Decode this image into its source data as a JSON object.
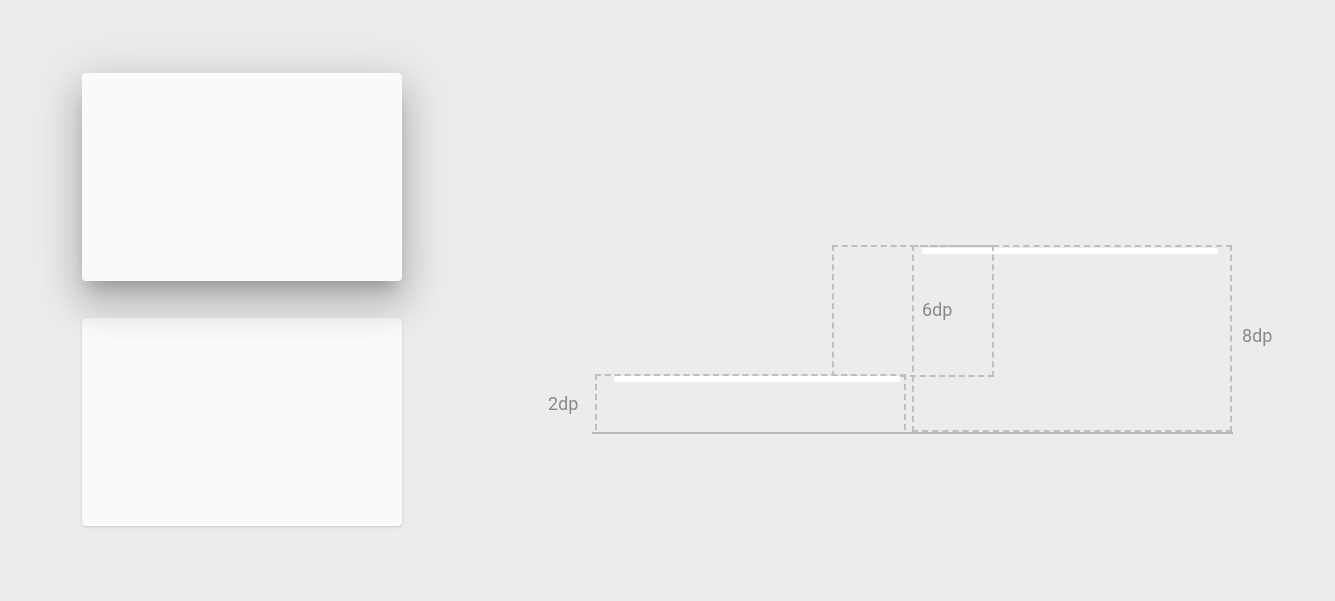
{
  "labels": {
    "dp8": "8dp",
    "dp6": "6dp",
    "dp2": "2dp"
  }
}
